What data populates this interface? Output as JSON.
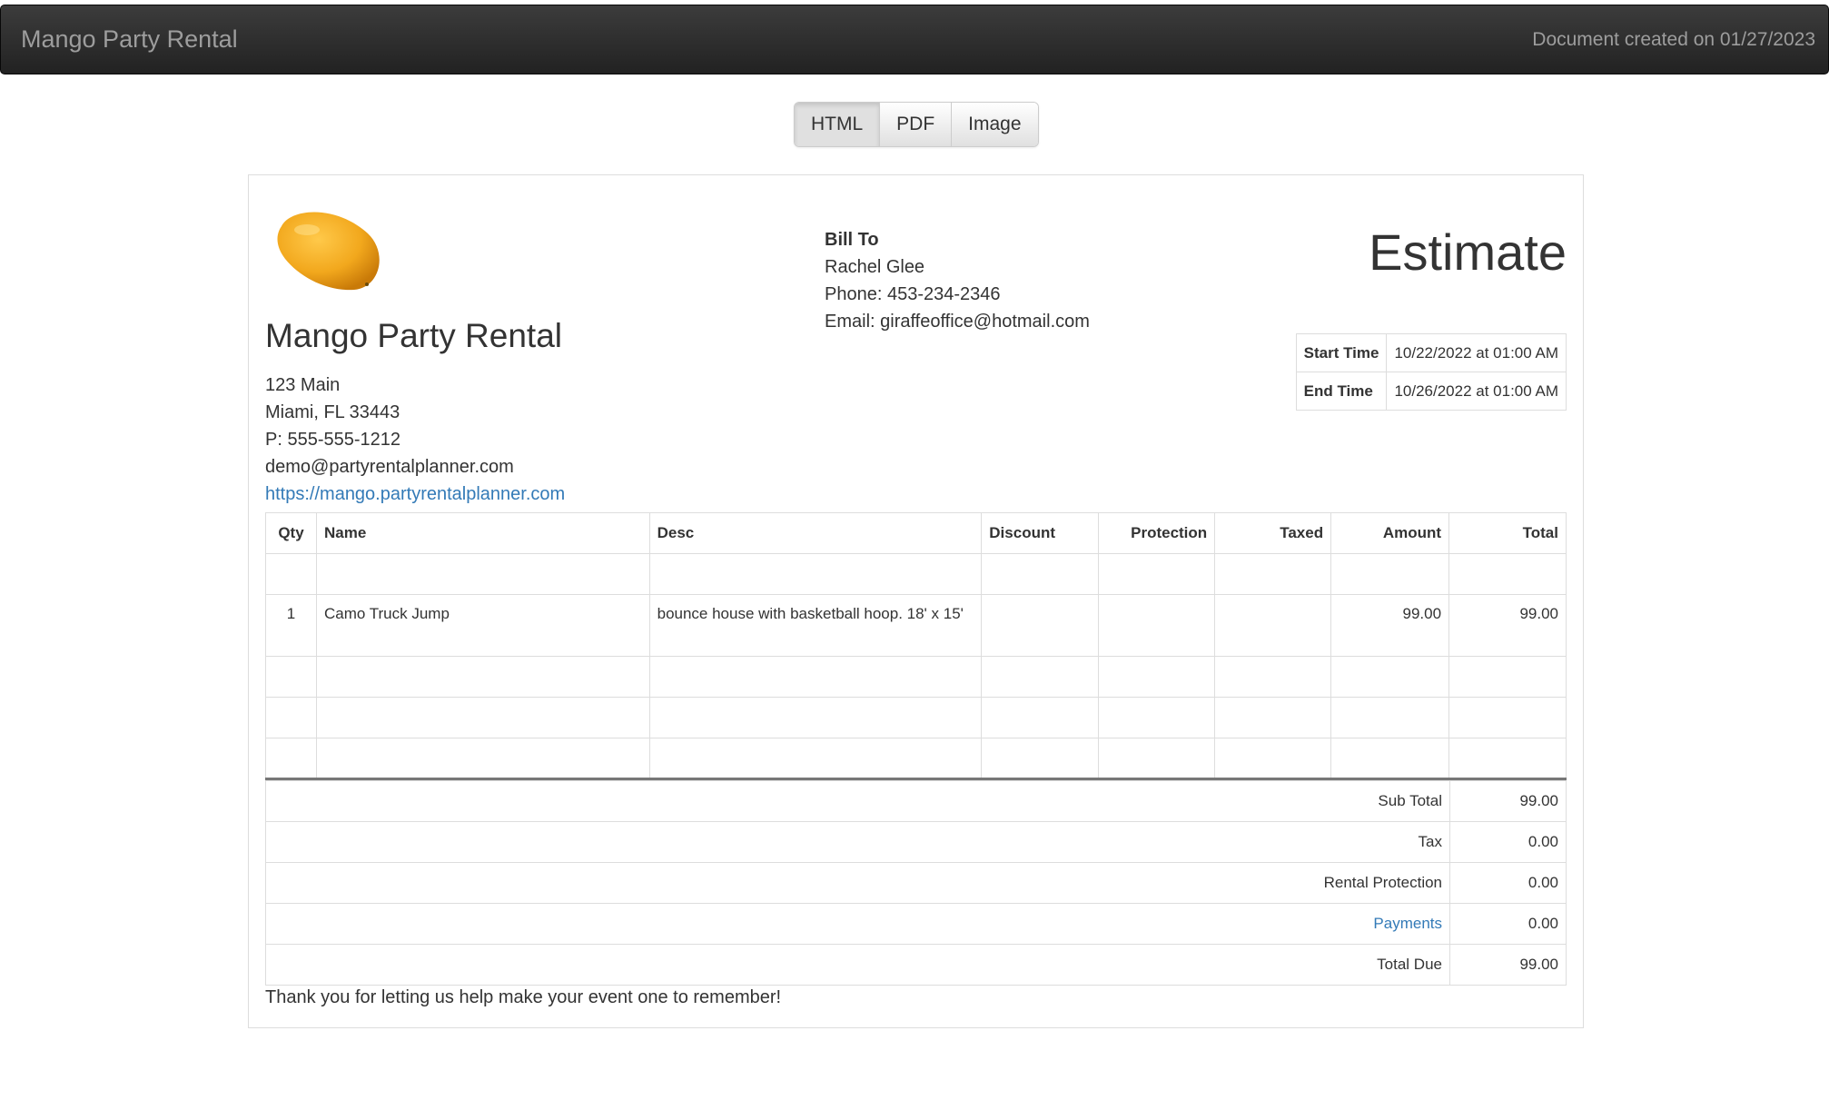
{
  "navbar": {
    "brand": "Mango Party Rental",
    "created": "Document created on 01/27/2023"
  },
  "formats": {
    "html": "HTML",
    "pdf": "PDF",
    "image": "Image"
  },
  "company": {
    "name": "Mango Party Rental",
    "address1": "123 Main",
    "address2": "Miami, FL 33443",
    "phone": "P: 555-555-1212",
    "email": "demo@partyrentalplanner.com",
    "website": "https://mango.partyrentalplanner.com"
  },
  "billto": {
    "label": "Bill To",
    "name": "Rachel Glee",
    "phone": "Phone: 453-234-2346",
    "email": "Email: giraffeoffice@hotmail.com"
  },
  "doc_type": "Estimate",
  "times": {
    "start_label": "Start Time",
    "start_value": "10/22/2022 at 01:00 AM",
    "end_label": "End Time",
    "end_value": "10/26/2022 at 01:00 AM"
  },
  "table": {
    "headers": {
      "qty": "Qty",
      "name": "Name",
      "desc": "Desc",
      "discount": "Discount",
      "protection": "Protection",
      "taxed": "Taxed",
      "amount": "Amount",
      "total": "Total"
    },
    "items": [
      {
        "qty": "1",
        "name": "Camo Truck Jump",
        "desc": "bounce house with basketball hoop. 18' x 15'",
        "discount": "",
        "protection": "",
        "taxed": "",
        "amount": "99.00",
        "total": "99.00"
      }
    ]
  },
  "totals": {
    "subtotal_label": "Sub Total",
    "subtotal": "99.00",
    "tax_label": "Tax",
    "tax": "0.00",
    "protection_label": "Rental Protection",
    "protection": "0.00",
    "payments_label": "Payments",
    "payments": "0.00",
    "due_label": "Total Due",
    "due": "99.00"
  },
  "footer_note": "Thank you for letting us help make your event one to remember!",
  "colors": {
    "navbar_bg": "#222222",
    "navbar_text": "#9d9d9d",
    "link": "#337ab7",
    "mango": "#f2a81d"
  }
}
